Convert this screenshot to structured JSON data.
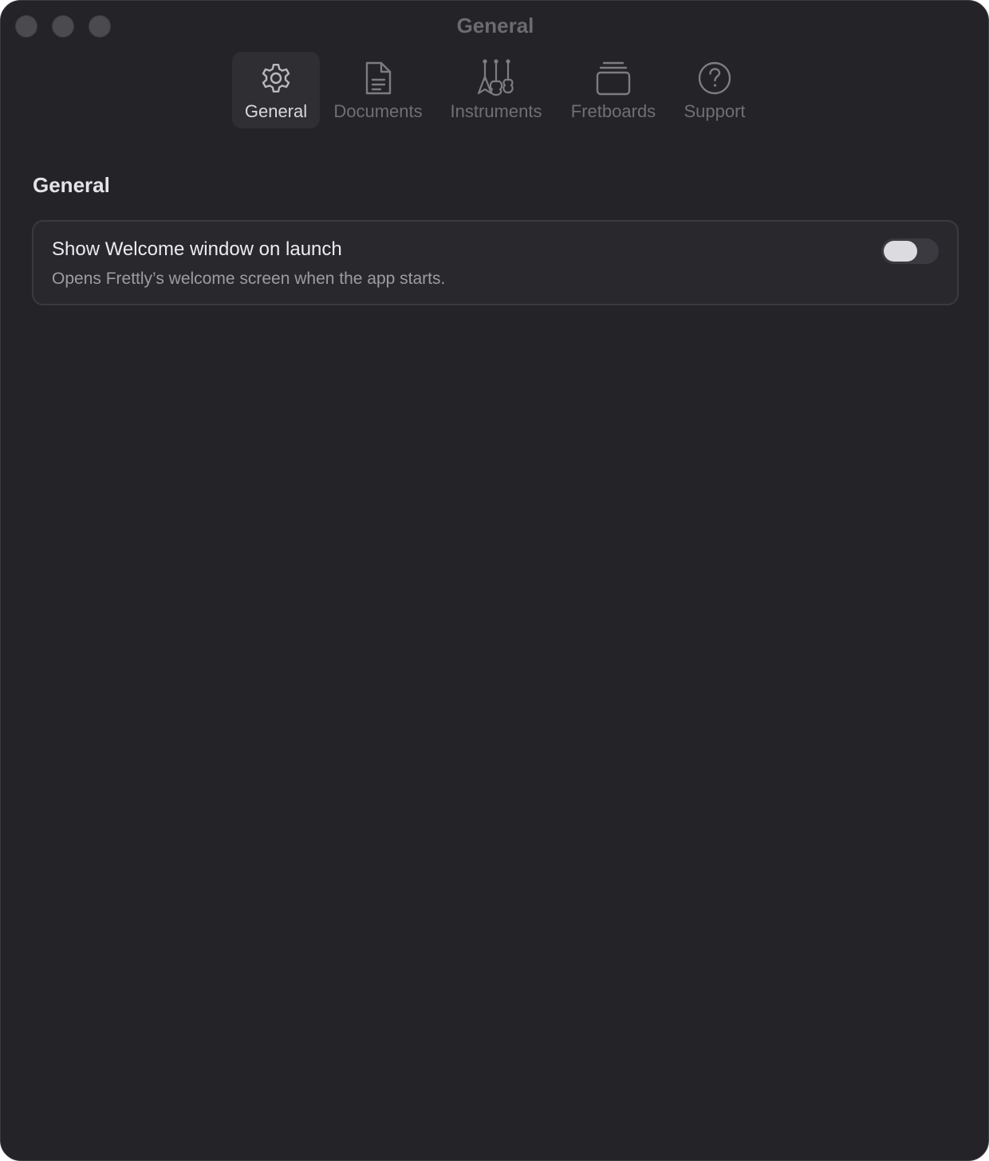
{
  "window": {
    "title": "General"
  },
  "toolbar": {
    "tabs": [
      {
        "label": "General",
        "icon": "gear-icon",
        "active": true
      },
      {
        "label": "Documents",
        "icon": "document-icon",
        "active": false
      },
      {
        "label": "Instruments",
        "icon": "guitars-icon",
        "active": false
      },
      {
        "label": "Fretboards",
        "icon": "stacked-cards-icon",
        "active": false
      },
      {
        "label": "Support",
        "icon": "question-circle-icon",
        "active": false
      }
    ]
  },
  "section": {
    "title": "General",
    "settings": [
      {
        "title": "Show Welcome window on launch",
        "description": "Opens Frettly’s welcome screen when the app starts.",
        "enabled": false
      }
    ]
  },
  "colors": {
    "window_bg": "#232328",
    "card_bg": "#28282d",
    "active_tab_bg": "#2e2e33",
    "inactive_text": "#6f6f74",
    "active_text": "#d8d8dc"
  }
}
